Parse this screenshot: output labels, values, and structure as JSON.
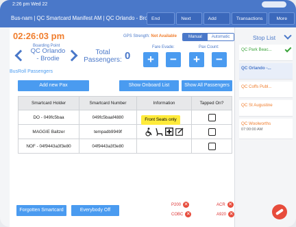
{
  "status": {
    "time": "2:26 pm  Wed 22"
  },
  "header": {
    "title": "Bus-nam | QC Smartcard Manifest AM  | QC Orlando - Bro...",
    "buttons": [
      "End Route",
      "Next Trip",
      "Add Fund",
      "Transactions",
      "More"
    ]
  },
  "clock": "02:26:03 pm",
  "gps": {
    "label": "GPS Strength:",
    "value": "Not Available"
  },
  "mode": {
    "manual": "Manual",
    "automatic": "Automatic"
  },
  "boarding": {
    "label": "Boarding Point",
    "name": "QC Orlando - Brodie"
  },
  "totals": {
    "label": "Total Passengers:",
    "count": "0"
  },
  "fare_evade": {
    "label": "Fare Evade:"
  },
  "pax_count": {
    "label": "Pax Count:"
  },
  "busroll_title": "BusRoll Passengers",
  "actions": {
    "add": "Add new Pax",
    "onboard": "Show Onboard List",
    "all": "Show All Passengers"
  },
  "table": {
    "columns": [
      "Smartcard Holder",
      "Smartcard Number",
      "Information",
      "Tapped On?"
    ],
    "rows": [
      {
        "holder": "DO - 049fc5baa",
        "number": "049fc5baaf4880"
      },
      {
        "holder": "MAGGIE Baltzer",
        "number": "tempadb9949f"
      },
      {
        "holder": "NOF - 04f9443a3f3e80",
        "number": "04f9443a3f3e80"
      }
    ]
  },
  "tooltip": "Front Seats only",
  "bottom": {
    "forgotten": "Forgotten Smartcard",
    "everybody_off": "Everybody Off"
  },
  "indicators": {
    "p200": "P200",
    "cobc": "COBC",
    "acr": "ACR",
    "a920": "A920"
  },
  "sidebar": {
    "title": "Stop List",
    "stops": [
      {
        "name": "QC Park Beac...",
        "state": "done"
      },
      {
        "name": "QC Orlando -...",
        "state": "current"
      },
      {
        "name": "QC Coffs Publ...",
        "state": "future"
      },
      {
        "name": "QC St Augustine",
        "state": "future"
      },
      {
        "name": "QC Woolworths",
        "state": "future",
        "time": "07:00:00 AM"
      }
    ]
  },
  "colors": {
    "accent": "#4a78c9",
    "button": "#4a9bf0",
    "warn": "#f07d2c",
    "danger": "#e74c3c",
    "ok": "#3aa33a"
  }
}
